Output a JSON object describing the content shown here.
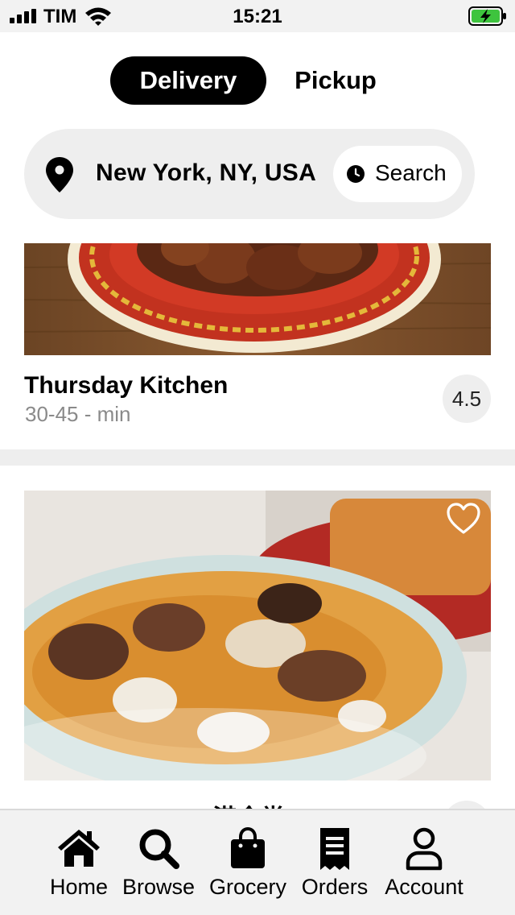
{
  "status_bar": {
    "carrier": "TIM",
    "time": "15:21"
  },
  "mode_toggle": {
    "delivery_label": "Delivery",
    "pickup_label": "Pickup",
    "active": "Delivery"
  },
  "location_bar": {
    "location": "New York, NY, USA",
    "search_label": "Search"
  },
  "restaurants": [
    {
      "name": "Thursday Kitchen",
      "eta": "30-45 - min",
      "rating": "4.5"
    },
    {
      "name": "Kang Sihk Tong 港食堂",
      "eta": "",
      "rating": ""
    }
  ],
  "tab_bar": {
    "tabs": [
      {
        "label": "Home",
        "icon": "home-icon"
      },
      {
        "label": "Browse",
        "icon": "search-icon"
      },
      {
        "label": "Grocery",
        "icon": "shopping-bag-icon"
      },
      {
        "label": "Orders",
        "icon": "receipt-icon"
      },
      {
        "label": "Account",
        "icon": "user-icon"
      }
    ]
  },
  "colors": {
    "accent": "#000000",
    "battery": "#3ec43e",
    "pill_bg": "#eeeeee"
  }
}
